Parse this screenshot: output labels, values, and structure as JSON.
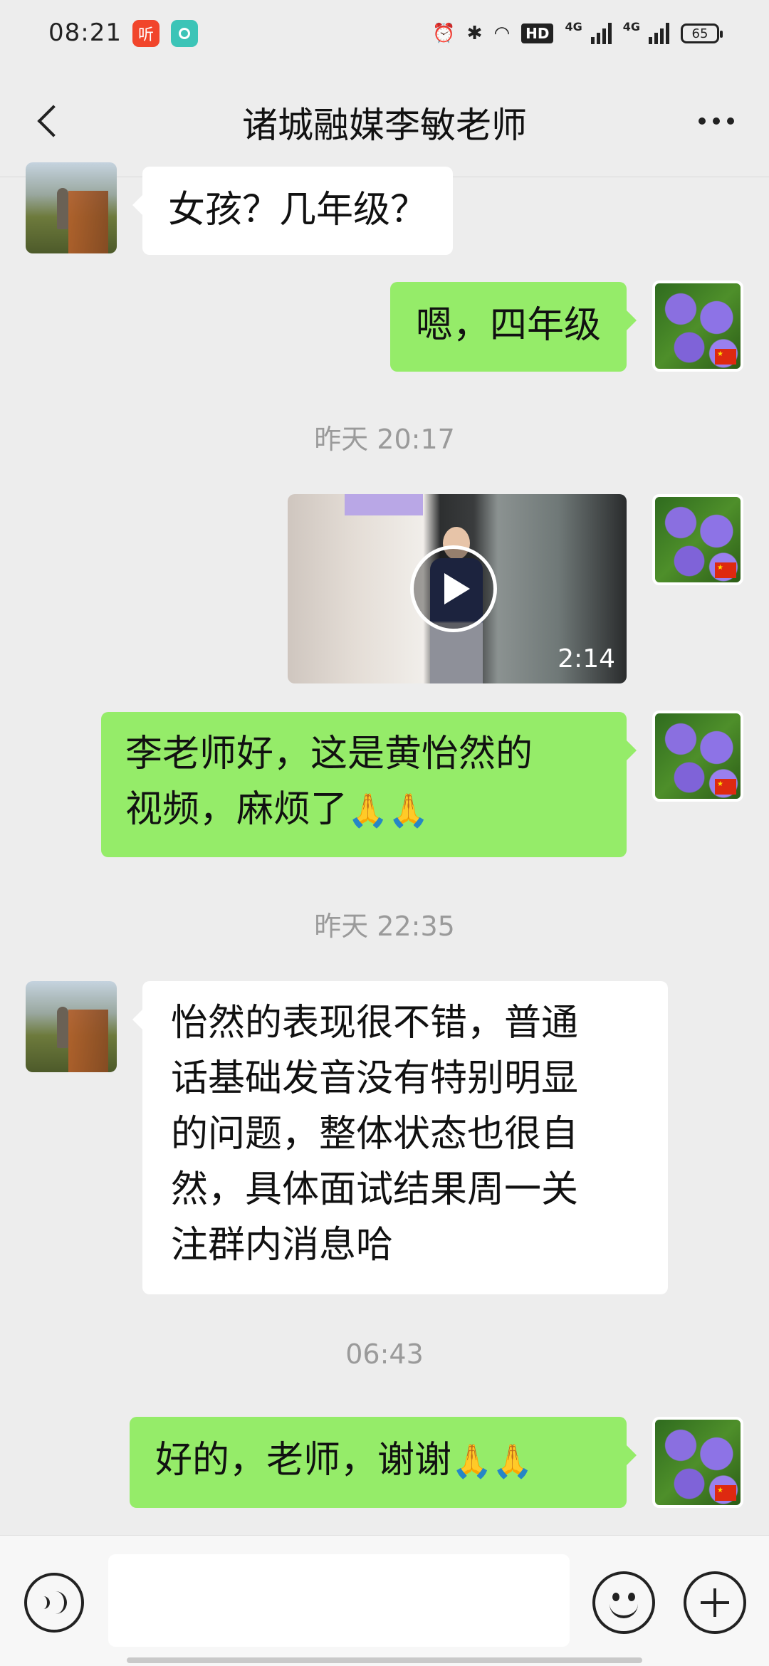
{
  "status_bar": {
    "time": "08:21",
    "badge_red_label": "听",
    "network_1": "4G",
    "network_2": "4G",
    "hd_label": "HD",
    "battery": "65"
  },
  "header": {
    "title": "诸城融媒李敏老师"
  },
  "messages": {
    "m1": "女孩？几年级？",
    "m2": "嗯，四年级",
    "ts1": "昨天 20:17",
    "video_duration": "2:14",
    "m3_line1": "李老师好，这是黄怡然的",
    "m3_line2": "视频，麻烦了",
    "m3_emoji": "🙏🙏",
    "ts2": "昨天 22:35",
    "m4_line1": "怡然的表现很不错，普通",
    "m4_line2": "话基础发音没有特别明显",
    "m4_line3": "的问题，整体状态也很自",
    "m4_line4": "然，具体面试结果周一关",
    "m4_line5": "注群内消息哈",
    "ts3": "06:43",
    "m5": "好的，老师，谢谢",
    "m5_emoji": "🙏🙏"
  },
  "input_bar": {
    "placeholder": ""
  },
  "colors": {
    "background": "#ededed",
    "my_bubble": "#95ec69",
    "their_bubble": "#ffffff"
  },
  "icons": [
    "back-icon",
    "more-icon",
    "voice-icon",
    "emoji-icon",
    "plus-icon",
    "play-icon",
    "alarm-icon",
    "bluetooth-icon",
    "wifi-icon",
    "battery-icon"
  ]
}
